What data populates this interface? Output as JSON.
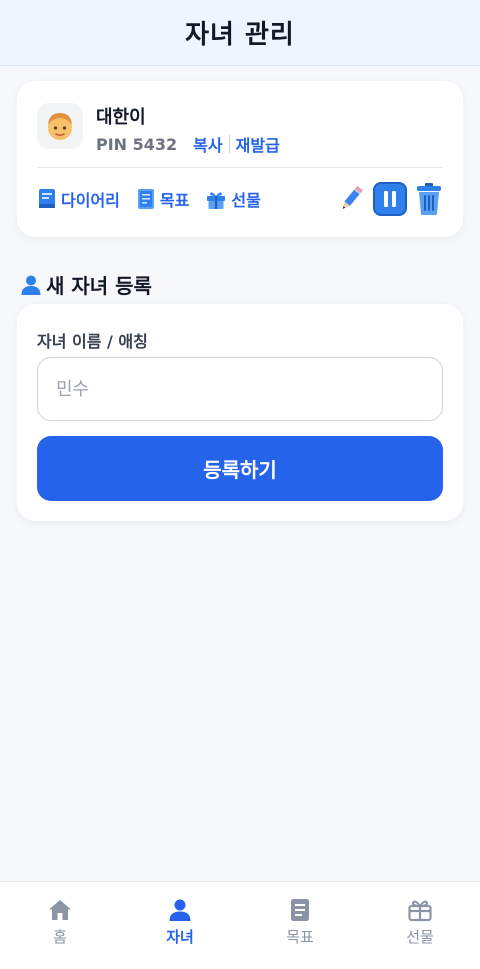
{
  "header": {
    "title": "자녀 관리"
  },
  "child": {
    "avatar": "boy-emoji",
    "name": "대한이",
    "pin": "PIN 5432",
    "copy_label": "복사",
    "reissue_label": "재발급",
    "actions": [
      {
        "icon": "diary-icon",
        "label": "다이어리"
      },
      {
        "icon": "goal-icon",
        "label": "목표"
      },
      {
        "icon": "gift-icon",
        "label": "선물"
      }
    ],
    "tools": [
      "pencil-icon",
      "pause-icon",
      "trash-icon"
    ]
  },
  "register": {
    "title": "새 자녀 등록",
    "field_label": "자녀 이름 / 애칭",
    "placeholder": "민수",
    "value": "",
    "submit_label": "등록하기"
  },
  "nav": {
    "items": [
      {
        "icon": "home-icon",
        "label": "홈",
        "active": false
      },
      {
        "icon": "person-icon",
        "label": "자녀",
        "active": true
      },
      {
        "icon": "document-icon",
        "label": "목표",
        "active": false
      },
      {
        "icon": "gift-icon",
        "label": "선물",
        "active": false
      }
    ]
  },
  "colors": {
    "accent": "#2563eb",
    "header_bg": "#eef5ff",
    "page_bg": "#f6f8fb",
    "muted": "#8a94a6"
  }
}
